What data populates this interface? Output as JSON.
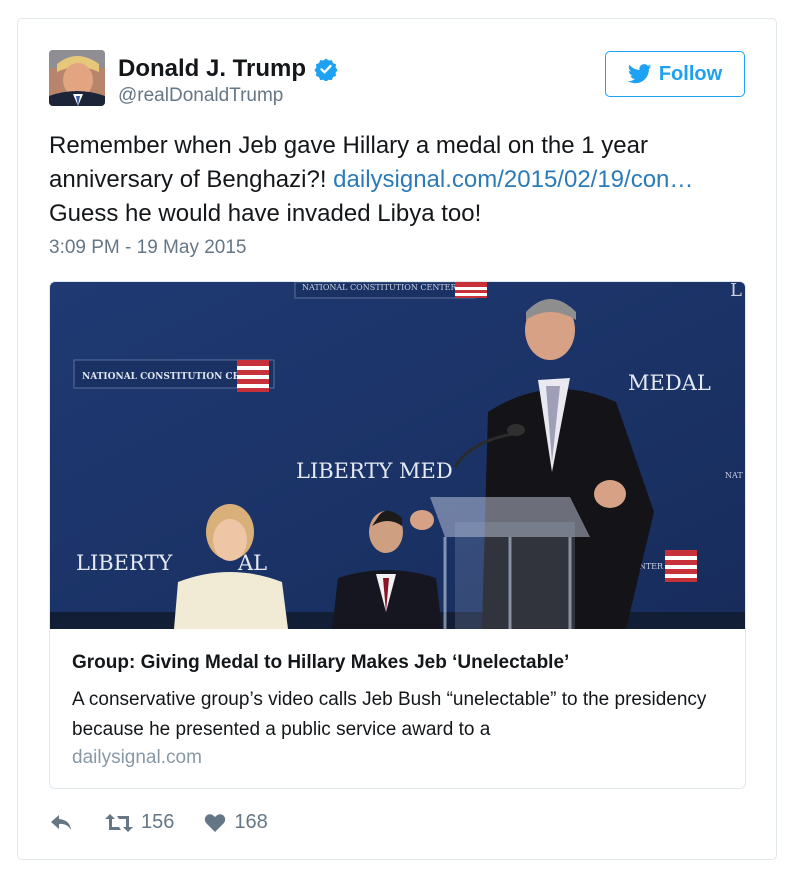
{
  "author": {
    "display_name": "Donald J. Trump",
    "handle": "@realDonaldTrump",
    "verified": true
  },
  "follow_label": "Follow",
  "tweet": {
    "text_part1": "Remember when Jeb gave Hillary a medal on the 1 year anniversary of Benghazi?! ",
    "link_text": "dailysignal.com/2015/02/19/con…",
    "text_part2": "Guess he would have invaded Libya too!",
    "timestamp": "3:09 PM - 19 May 2015"
  },
  "card": {
    "image_signs": {
      "ncc_top": "NATIONAL CONSTITUTION CENTER",
      "ncc_left": "NATIONAL CONSTITUTION CENTER",
      "medal_right": "MEDAL",
      "liberty_medal_center": "LIBERTY MED",
      "liberty_medal_left": "LIBERTY",
      "liberty_medal_left_end": "AL",
      "nat_right": "NAT",
      "center_right": "ENTER",
      "corner_letter": "L"
    },
    "title": "Group: Giving Medal to Hillary Makes Jeb ‘Unelectable’",
    "description": "A conservative group’s video calls Jeb Bush “unelectable” to the presidency because he presented a public service award to a",
    "domain": "dailysignal.com"
  },
  "actions": {
    "retweets": "156",
    "likes": "168"
  },
  "colors": {
    "accent": "#1da1f2",
    "link": "#2b7bb9",
    "secondary_text": "#657786",
    "border": "#e1e8ed"
  },
  "icons": [
    "verified-badge-icon",
    "twitter-bird-icon",
    "reply-icon",
    "retweet-icon",
    "heart-icon"
  ]
}
